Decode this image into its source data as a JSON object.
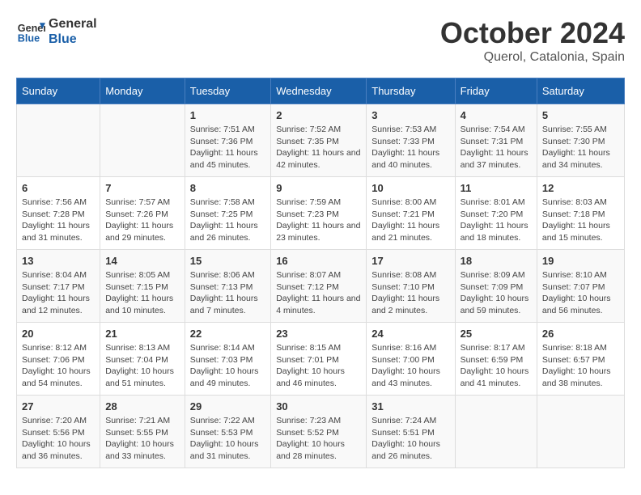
{
  "header": {
    "logo_general": "General",
    "logo_blue": "Blue",
    "month_title": "October 2024",
    "location": "Querol, Catalonia, Spain"
  },
  "weekdays": [
    "Sunday",
    "Monday",
    "Tuesday",
    "Wednesday",
    "Thursday",
    "Friday",
    "Saturday"
  ],
  "weeks": [
    [
      {
        "day": "",
        "info": ""
      },
      {
        "day": "",
        "info": ""
      },
      {
        "day": "1",
        "info": "Sunrise: 7:51 AM\nSunset: 7:36 PM\nDaylight: 11 hours and 45 minutes."
      },
      {
        "day": "2",
        "info": "Sunrise: 7:52 AM\nSunset: 7:35 PM\nDaylight: 11 hours and 42 minutes."
      },
      {
        "day": "3",
        "info": "Sunrise: 7:53 AM\nSunset: 7:33 PM\nDaylight: 11 hours and 40 minutes."
      },
      {
        "day": "4",
        "info": "Sunrise: 7:54 AM\nSunset: 7:31 PM\nDaylight: 11 hours and 37 minutes."
      },
      {
        "day": "5",
        "info": "Sunrise: 7:55 AM\nSunset: 7:30 PM\nDaylight: 11 hours and 34 minutes."
      }
    ],
    [
      {
        "day": "6",
        "info": "Sunrise: 7:56 AM\nSunset: 7:28 PM\nDaylight: 11 hours and 31 minutes."
      },
      {
        "day": "7",
        "info": "Sunrise: 7:57 AM\nSunset: 7:26 PM\nDaylight: 11 hours and 29 minutes."
      },
      {
        "day": "8",
        "info": "Sunrise: 7:58 AM\nSunset: 7:25 PM\nDaylight: 11 hours and 26 minutes."
      },
      {
        "day": "9",
        "info": "Sunrise: 7:59 AM\nSunset: 7:23 PM\nDaylight: 11 hours and 23 minutes."
      },
      {
        "day": "10",
        "info": "Sunrise: 8:00 AM\nSunset: 7:21 PM\nDaylight: 11 hours and 21 minutes."
      },
      {
        "day": "11",
        "info": "Sunrise: 8:01 AM\nSunset: 7:20 PM\nDaylight: 11 hours and 18 minutes."
      },
      {
        "day": "12",
        "info": "Sunrise: 8:03 AM\nSunset: 7:18 PM\nDaylight: 11 hours and 15 minutes."
      }
    ],
    [
      {
        "day": "13",
        "info": "Sunrise: 8:04 AM\nSunset: 7:17 PM\nDaylight: 11 hours and 12 minutes."
      },
      {
        "day": "14",
        "info": "Sunrise: 8:05 AM\nSunset: 7:15 PM\nDaylight: 11 hours and 10 minutes."
      },
      {
        "day": "15",
        "info": "Sunrise: 8:06 AM\nSunset: 7:13 PM\nDaylight: 11 hours and 7 minutes."
      },
      {
        "day": "16",
        "info": "Sunrise: 8:07 AM\nSunset: 7:12 PM\nDaylight: 11 hours and 4 minutes."
      },
      {
        "day": "17",
        "info": "Sunrise: 8:08 AM\nSunset: 7:10 PM\nDaylight: 11 hours and 2 minutes."
      },
      {
        "day": "18",
        "info": "Sunrise: 8:09 AM\nSunset: 7:09 PM\nDaylight: 10 hours and 59 minutes."
      },
      {
        "day": "19",
        "info": "Sunrise: 8:10 AM\nSunset: 7:07 PM\nDaylight: 10 hours and 56 minutes."
      }
    ],
    [
      {
        "day": "20",
        "info": "Sunrise: 8:12 AM\nSunset: 7:06 PM\nDaylight: 10 hours and 54 minutes."
      },
      {
        "day": "21",
        "info": "Sunrise: 8:13 AM\nSunset: 7:04 PM\nDaylight: 10 hours and 51 minutes."
      },
      {
        "day": "22",
        "info": "Sunrise: 8:14 AM\nSunset: 7:03 PM\nDaylight: 10 hours and 49 minutes."
      },
      {
        "day": "23",
        "info": "Sunrise: 8:15 AM\nSunset: 7:01 PM\nDaylight: 10 hours and 46 minutes."
      },
      {
        "day": "24",
        "info": "Sunrise: 8:16 AM\nSunset: 7:00 PM\nDaylight: 10 hours and 43 minutes."
      },
      {
        "day": "25",
        "info": "Sunrise: 8:17 AM\nSunset: 6:59 PM\nDaylight: 10 hours and 41 minutes."
      },
      {
        "day": "26",
        "info": "Sunrise: 8:18 AM\nSunset: 6:57 PM\nDaylight: 10 hours and 38 minutes."
      }
    ],
    [
      {
        "day": "27",
        "info": "Sunrise: 7:20 AM\nSunset: 5:56 PM\nDaylight: 10 hours and 36 minutes."
      },
      {
        "day": "28",
        "info": "Sunrise: 7:21 AM\nSunset: 5:55 PM\nDaylight: 10 hours and 33 minutes."
      },
      {
        "day": "29",
        "info": "Sunrise: 7:22 AM\nSunset: 5:53 PM\nDaylight: 10 hours and 31 minutes."
      },
      {
        "day": "30",
        "info": "Sunrise: 7:23 AM\nSunset: 5:52 PM\nDaylight: 10 hours and 28 minutes."
      },
      {
        "day": "31",
        "info": "Sunrise: 7:24 AM\nSunset: 5:51 PM\nDaylight: 10 hours and 26 minutes."
      },
      {
        "day": "",
        "info": ""
      },
      {
        "day": "",
        "info": ""
      }
    ]
  ]
}
